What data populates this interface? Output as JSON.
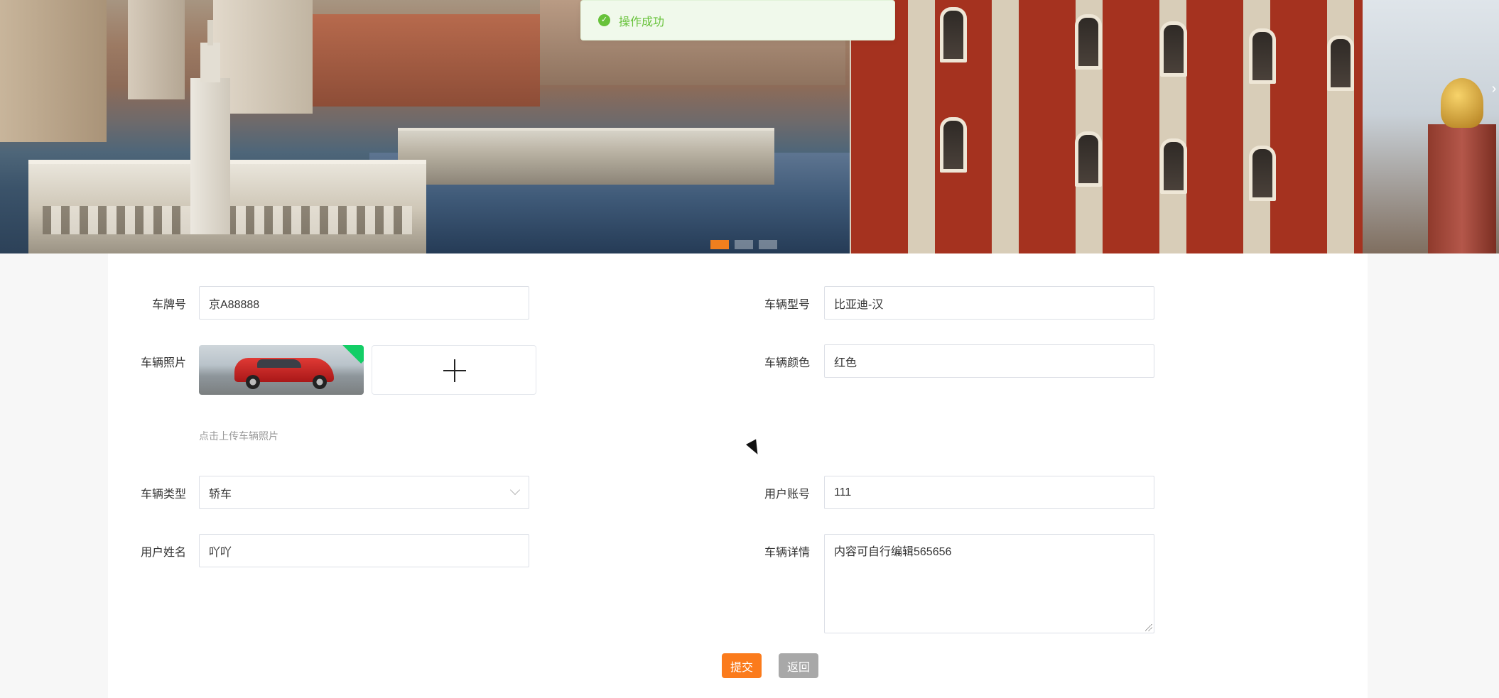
{
  "toast": {
    "message": "操作成功",
    "icon": "success-check-icon"
  },
  "carousel": {
    "slide_count": 3,
    "active_index": 0,
    "next_icon": "›"
  },
  "form": {
    "plate": {
      "label": "车牌号",
      "value": "京A88888"
    },
    "model": {
      "label": "车辆型号",
      "value": "比亚迪-汉"
    },
    "photo": {
      "label": "车辆照片",
      "hint": "点击上传车辆照片"
    },
    "color": {
      "label": "车辆颜色",
      "value": "红色"
    },
    "type": {
      "label": "车辆类型",
      "value": "轿车"
    },
    "account": {
      "label": "用户账号",
      "value": "111"
    },
    "username": {
      "label": "用户姓名",
      "value": "吖吖"
    },
    "details": {
      "label": "车辆详情",
      "value": "内容可自行编辑565656"
    }
  },
  "actions": {
    "submit_label": "提交",
    "back_label": "返回"
  },
  "colors": {
    "accent": "#fb7b1c",
    "success": "#67c23a",
    "back": "#a8a8a8"
  }
}
